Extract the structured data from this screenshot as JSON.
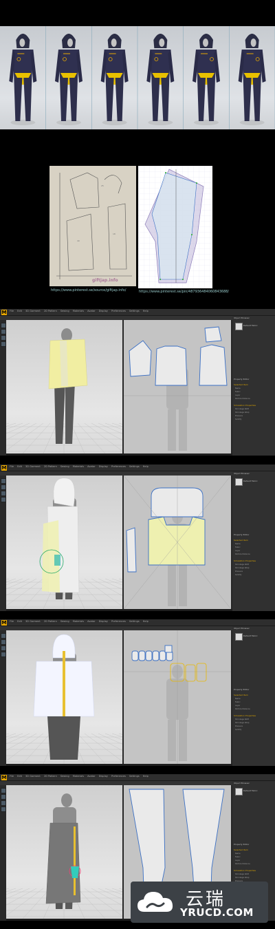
{
  "references": {
    "watermark": "giftjap.info",
    "url_left": "https://www.pinterest.se/source/giftjap.info/",
    "url_right": "https://www.pinterest.se/pin/487936484060843688/"
  },
  "app": {
    "logo": "M",
    "menu_items": [
      "File",
      "Edit",
      "3D Garment",
      "2D Pattern",
      "Sewing",
      "Materials",
      "Avatar",
      "Display",
      "Preferences",
      "Settings",
      "Help"
    ],
    "right_panel_title": "Object Browser",
    "right_panel_inspector": "Property Editor",
    "fabric_label": "Default Fabric",
    "section_labels": [
      "Selected Item",
      "Simulation Properties"
    ],
    "property_labels": [
      "Name",
      "Fabric",
      "Layer",
      "Particle Distance",
      "Shrinkage Weft",
      "Shrinkage Warp",
      "Pressure",
      "Solidify"
    ]
  },
  "banner": {
    "title": "云瑞",
    "subtitle": "YRUCD.COM"
  },
  "colors": {
    "background": "#000000",
    "accent": "#e8a800",
    "garment_yellow": "#f1eea2",
    "pattern_blue": "#3a6fc4"
  }
}
